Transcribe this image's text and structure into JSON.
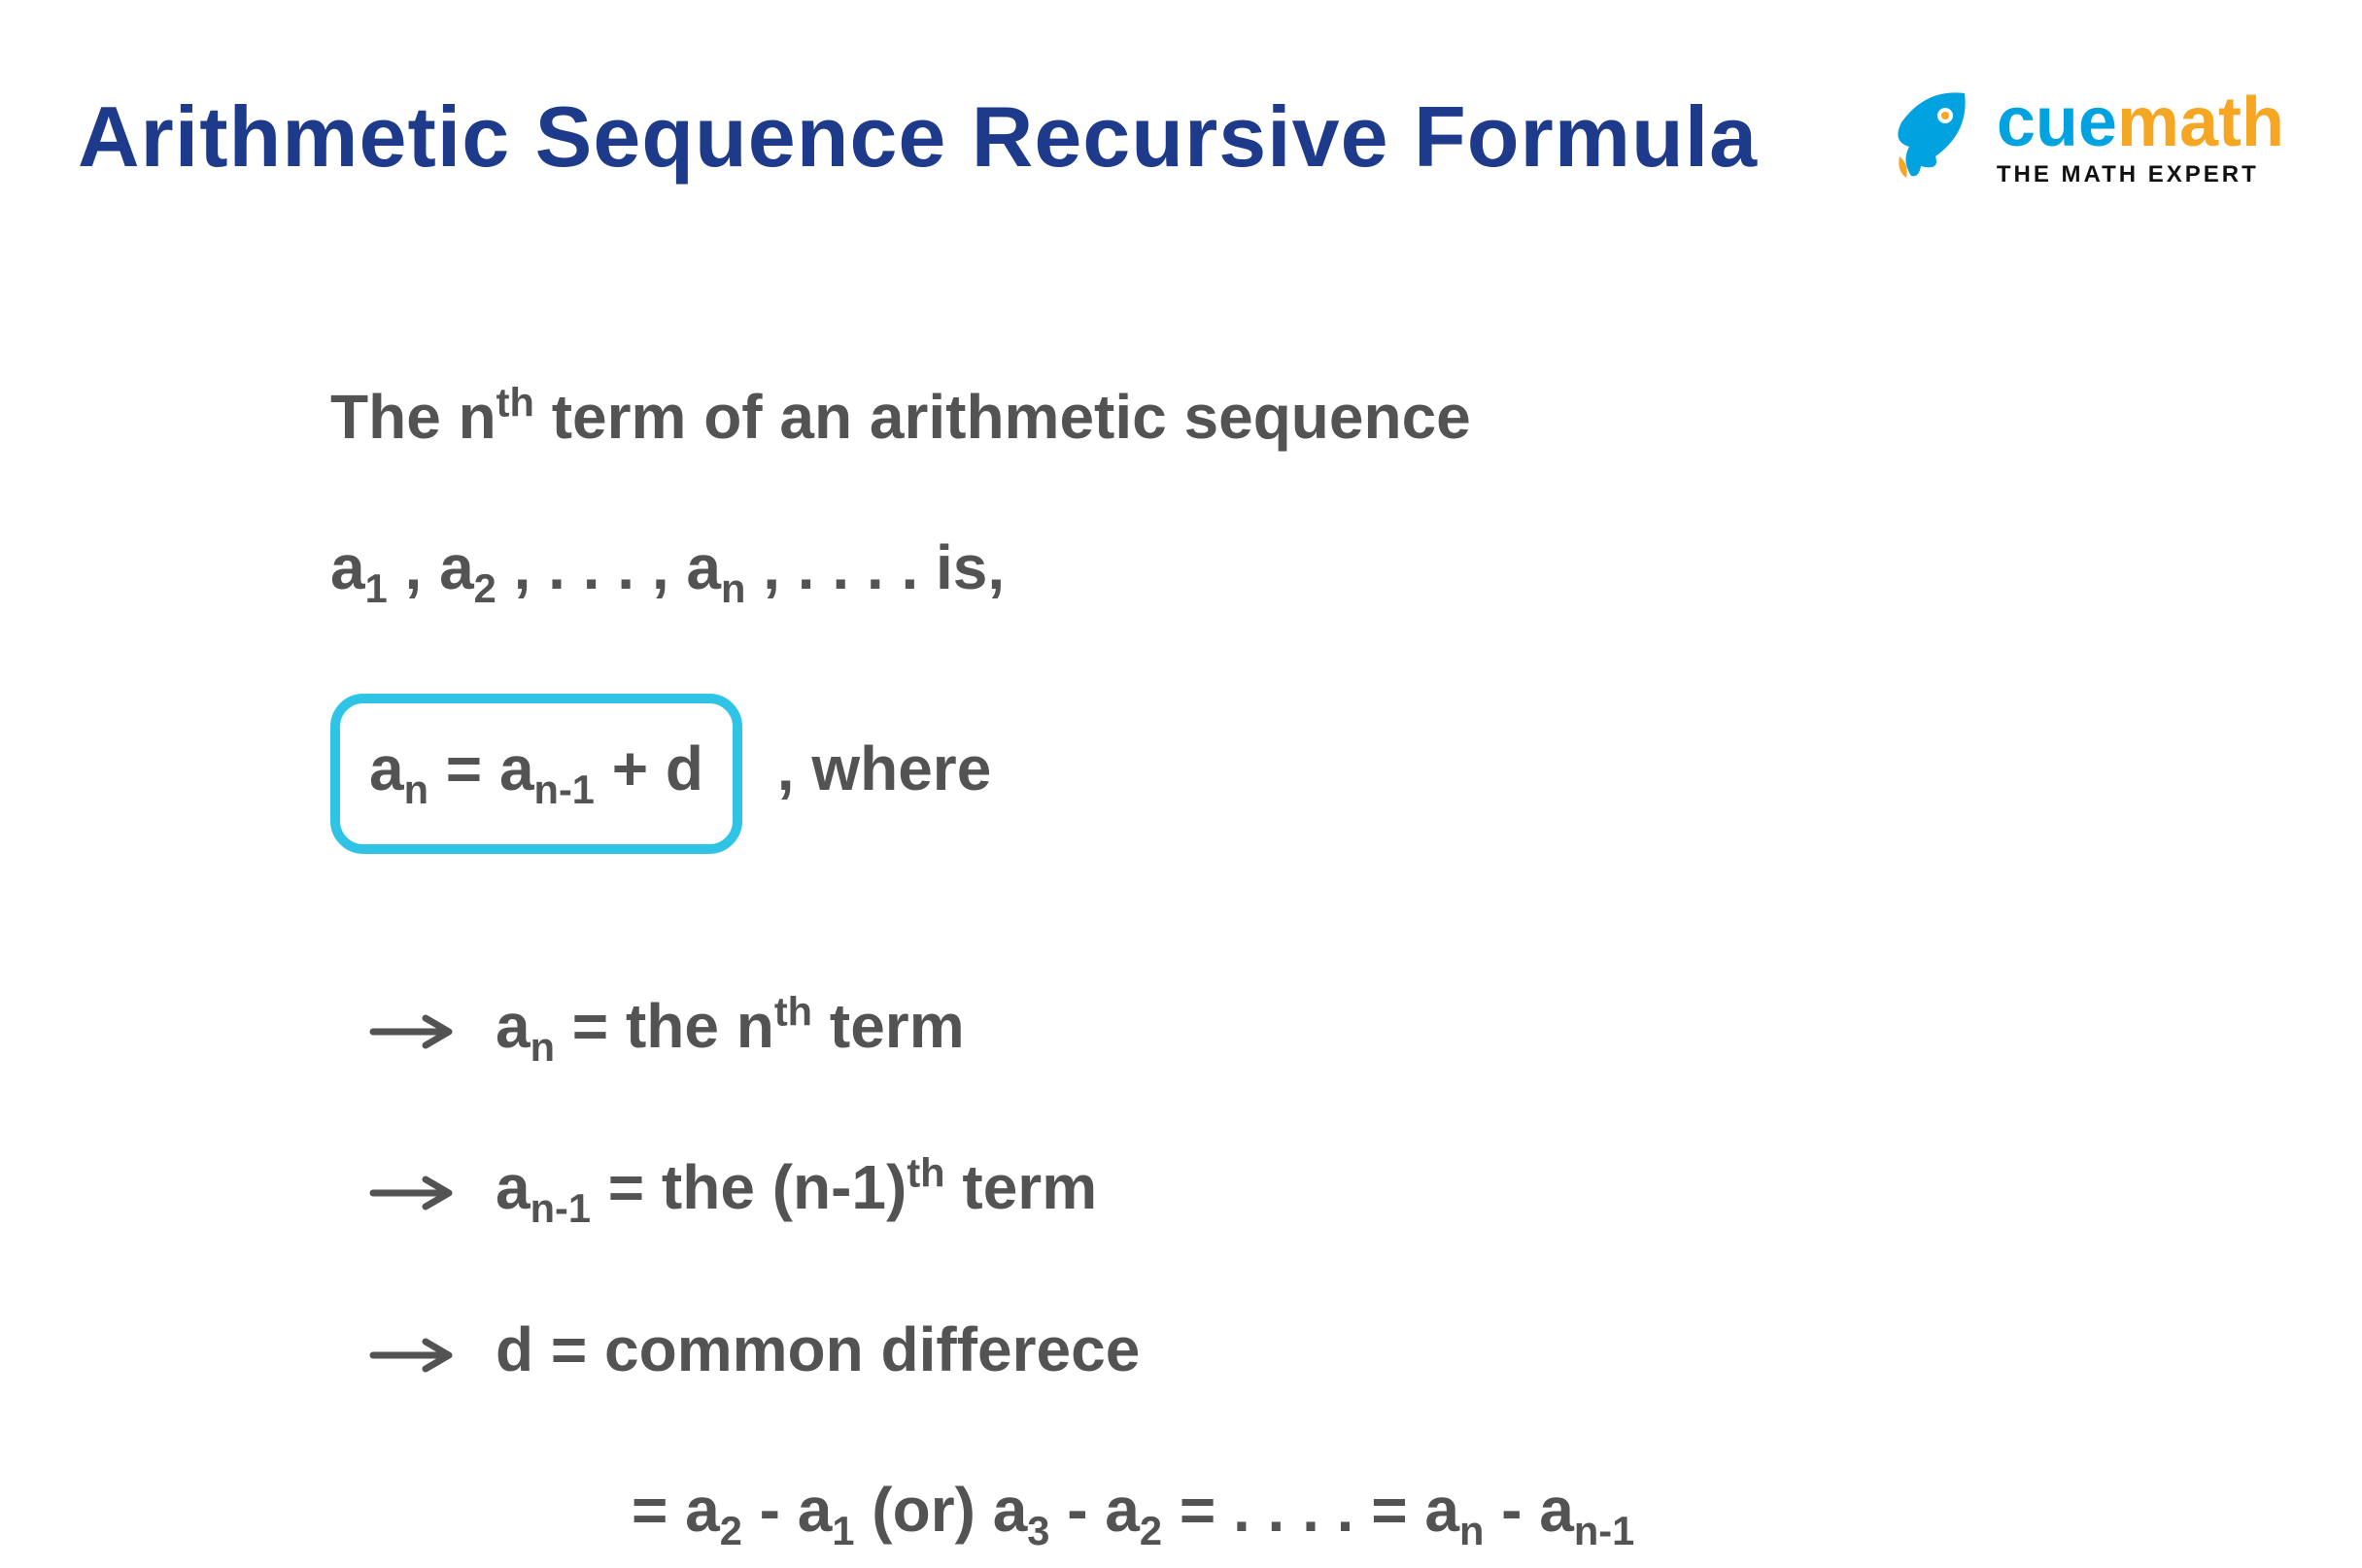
{
  "title": "Arithmetic Sequence Recursive Formula",
  "logo": {
    "brand_cue": "cue",
    "brand_math": "math",
    "tagline": "THE MATH EXPERT"
  },
  "body": {
    "intro_pre": "The n",
    "intro_sup": "th",
    "intro_post": " term of an arithmetic sequence",
    "seq_a": "a",
    "seq_s1": "1",
    "seq_c1": " , ",
    "seq_s2": "2",
    "seq_c2": " , . . . , ",
    "seq_sn": "n",
    "seq_c3": " , . . . .   is,",
    "formula_a": "a",
    "formula_sub_n": "n",
    "formula_eq": " =  ",
    "formula_a2": "a",
    "formula_sub_nm1": "n-1",
    "formula_plus_d": " + d",
    "where": ",  where",
    "def1_lhs_a": "a",
    "def1_lhs_sub": "n",
    "def1_eq": " =  the n",
    "def1_sup": "th",
    "def1_post": " term",
    "def2_lhs_a": "a",
    "def2_lhs_sub": "n-1",
    "def2_eq": "  =  the (n-1)",
    "def2_sup": "th",
    "def2_post": " term",
    "def3_lhs": "d",
    "def3_eq": "  =  common differece",
    "def3b_eq": "= ",
    "def3b_a": "a",
    "def3b_s2": "2",
    "def3b_minus": " - ",
    "def3b_s1": "1",
    "def3b_or": " (or) ",
    "def3b_s3": "3",
    "def3b_dots": " = . . . . =  ",
    "def3b_sn": "n",
    "def3b_snm1": "n-1"
  }
}
